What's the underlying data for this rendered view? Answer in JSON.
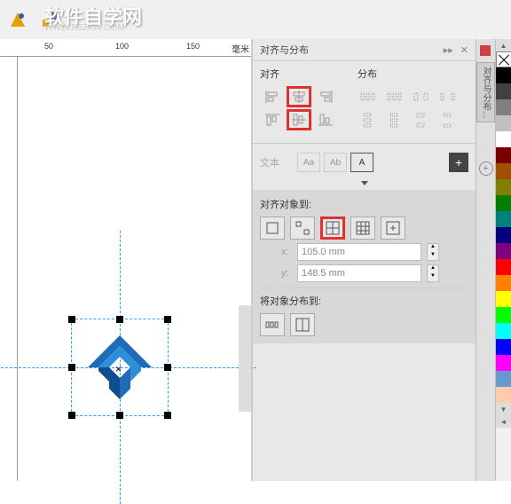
{
  "watermark": {
    "title": "软件自学网",
    "sub": "WWW.RJZXW.COM"
  },
  "ruler": {
    "marks": [
      "50",
      "100",
      "150"
    ],
    "unit": "毫米"
  },
  "panel": {
    "title": "对齐与分布",
    "align_label": "对齐",
    "distribute_label": "分布",
    "text_label": "文本",
    "align_to_label": "对齐对象到:",
    "distribute_to_label": "将对象分布到:",
    "coords": {
      "x_label": "x:",
      "y_label": "y:",
      "x_value": "105.0 mm",
      "y_value": "148.5 mm"
    }
  },
  "side_tab": {
    "label": "对齐与分布..."
  },
  "colors": [
    "#000000",
    "#404040",
    "#808080",
    "#c0c0c0",
    "#ffffff",
    "#7a0000",
    "#a05000",
    "#808000",
    "#008000",
    "#008080",
    "#000080",
    "#800080",
    "#ff0000",
    "#ff8000",
    "#ffff00",
    "#00ff00",
    "#00ffff",
    "#0000ff",
    "#ff00ff",
    "#6699cc",
    "#ffccaa"
  ]
}
